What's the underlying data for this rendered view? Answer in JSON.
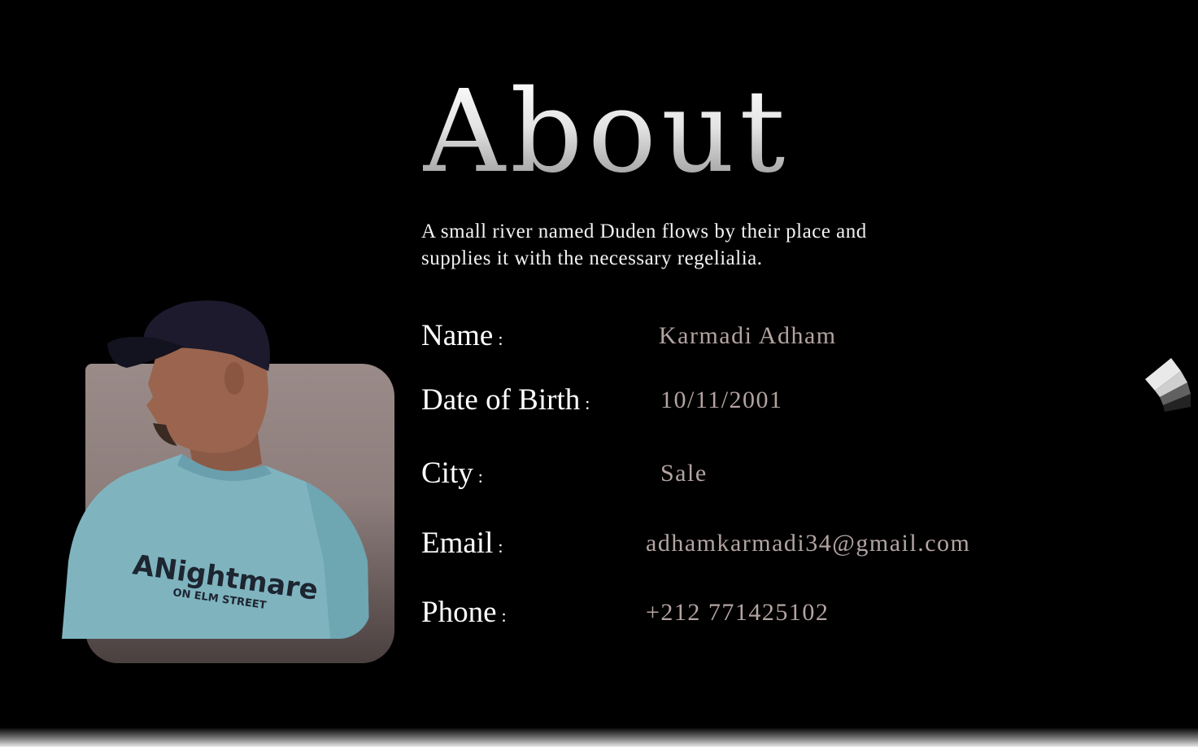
{
  "about": {
    "title": "About",
    "intro": "A small river named Duden flows by their place and supplies it with the necessary regelialia."
  },
  "info": {
    "colon": ":",
    "rows": [
      {
        "label": "Name",
        "value": "Karmadi Adham"
      },
      {
        "label": "Date of Birth",
        "value": "10/11/2001"
      },
      {
        "label": "City",
        "value": "Sale"
      },
      {
        "label": "Email",
        "value": "adhamkarmadi34@gmail.com"
      },
      {
        "label": "Phone",
        "value": "+212 771425102"
      }
    ]
  },
  "photo": {
    "shirt_text_main": "ANightmare",
    "shirt_text_sub": "ON ELM STREET"
  },
  "nav": {
    "icon": "arrow-icon"
  },
  "colors": {
    "background": "#000000",
    "label": "#ffffff",
    "value": "#b3a4a2",
    "frame": "#9a8b89"
  }
}
